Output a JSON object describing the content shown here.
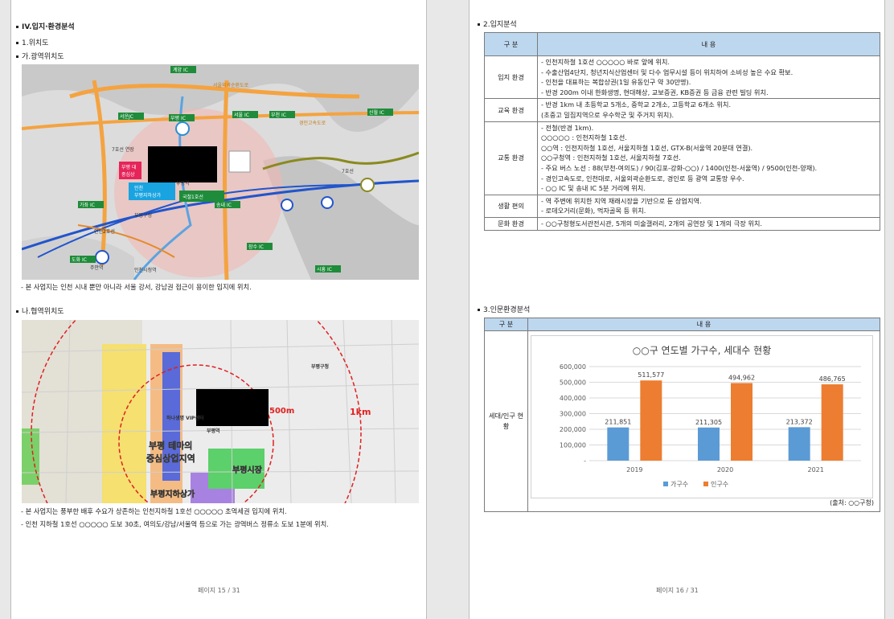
{
  "left": {
    "section_title": "IV.입지·환경분석",
    "sub1": "1.위치도",
    "sub1a": "가.광역위치도",
    "map1": {
      "labels": [
        "계양 IC",
        "서울외곽순환도로",
        "서운JC",
        "부평 IC",
        "서울 IC",
        "부천 IC",
        "신월 IC",
        "경인고속도로",
        "7호선 연장",
        "부평 대",
        "중심상",
        "인천",
        "부평지하상가",
        "국철1호선",
        "송내 IC",
        "가좌 IC",
        "7호선",
        "인천2호선",
        "도화 IC",
        "주안역",
        "인천시청역",
        "장수 IC",
        "시흥 IC",
        "부평역",
        "부평구청"
      ]
    },
    "caption1": "- 본 사업지는 인천 시내 뿐만 아니라 서울 강서, 강남권 접근이 용이한 입지에 위치.",
    "sub1b": "나.협역위치도",
    "map2": {
      "labels": [
        "500m",
        "1km",
        "부평 테마의",
        "중심상업지역",
        "부평시장",
        "부평지하상가",
        "하나생명 VIP센터",
        "부평역",
        "부평구청"
      ]
    },
    "caption2": "- 본 사업지는 풍부한 배후 수요가 상존하는 인천지하철 1호선 ○○○○○ 초역세권 입지에 위치.",
    "caption3": "- 인천 지하철 1호선 ○○○○○ 도보 30초, 여의도/강남/서울역 등으로 가는 광역버스 정류소 도보 1분에 위치.",
    "footer": "페이지 15 / 31"
  },
  "right": {
    "sub2": "2.입지분석",
    "table": {
      "header_cat": "구 분",
      "header_content": "내 용",
      "rows": [
        {
          "cat": "입지 환경",
          "lines": [
            "- 인천지하철 1호선 ○○○○○ 바로 앞에 위치.",
            "- 수출산업4단지, 청년지식산업센터 및 다수 업무시설 등이 위치하여 소비성 높은 수요 확보.",
            "- 인천을 대표하는 복합상권(1일 유동인구 약 30만명).",
            "- 반경 200m 이내 한화생명, 현대해상, 교보증권, KB증권 등 금융 관련 빌딩 위치."
          ]
        },
        {
          "cat": "교육 환경",
          "lines": [
            "- 반경 1km 내 초등학교 5개소, 중학교 2개소, 고등학교 6개소 위치.",
            "  (초중고 밀집지역으로 우수학군 및 주거지 위치)."
          ]
        },
        {
          "cat": "교통 환경",
          "lines": [
            "- 전철(반경 1km).",
            "  ○○○○○ : 인천지하철 1호선.",
            "  ○○역 : 인천지하철 1호선, 서울지하철 1호선, GTX-B(서울역 20분대 연결).",
            "  ○○구청역 : 인천지하철 1호선, 서울지하철 7호선.",
            "- 주요 버스 노선 : 88(부천-여의도) / 90(김포-강화-○○) / 1400(인천-서울역) / 9500(인천-양재).",
            "- 경인고속도로, 인천대로, 서울외곽순환도로, 경인로 등 광역 교통망 우수.",
            "- ○○ IC 및 송내 IC 5분 거리에 위치."
          ]
        },
        {
          "cat": "생활 편의",
          "lines": [
            "- 역 주변에 위치한 지역 재래시장을 기반으로 둔 상업지역.",
            "- 로데오거리(문화), 먹자골목 등 위치."
          ]
        },
        {
          "cat": "문화 환경",
          "lines": [
            "- ○○구청형도서관전시관, 5개의 미술갤러리, 2개의 공연장 및 1개의 극장 위치."
          ]
        }
      ]
    },
    "sub3": "3.인문환경분석",
    "table2": {
      "header_cat": "구 분",
      "header_content": "내 용",
      "row_cat": "세대/인구 현황",
      "source": "(출처: ○○구청)"
    },
    "footer": "페이지 16 / 31",
    "colors": {
      "households": "#5b9bd5",
      "population": "#ed7d31",
      "header_bg": "#bdd7ee"
    }
  },
  "chart_data": {
    "type": "bar",
    "title": "○○구 연도별 가구수, 세대수 현황",
    "categories": [
      "2019",
      "2020",
      "2021"
    ],
    "series": [
      {
        "name": "가구수",
        "values": [
          211851,
          211305,
          213372
        ]
      },
      {
        "name": "인구수",
        "values": [
          511577,
          494962,
          486765
        ]
      }
    ],
    "ylim": [
      0,
      600000
    ],
    "yticks": [
      "600,000",
      "500,000",
      "400,000",
      "300,000",
      "200,000",
      "100,000",
      "-"
    ],
    "data_labels": [
      [
        "211,851",
        "211,305",
        "213,372"
      ],
      [
        "511,577",
        "494,962",
        "486,765"
      ]
    ],
    "legend": "bottom",
    "grid": true
  }
}
